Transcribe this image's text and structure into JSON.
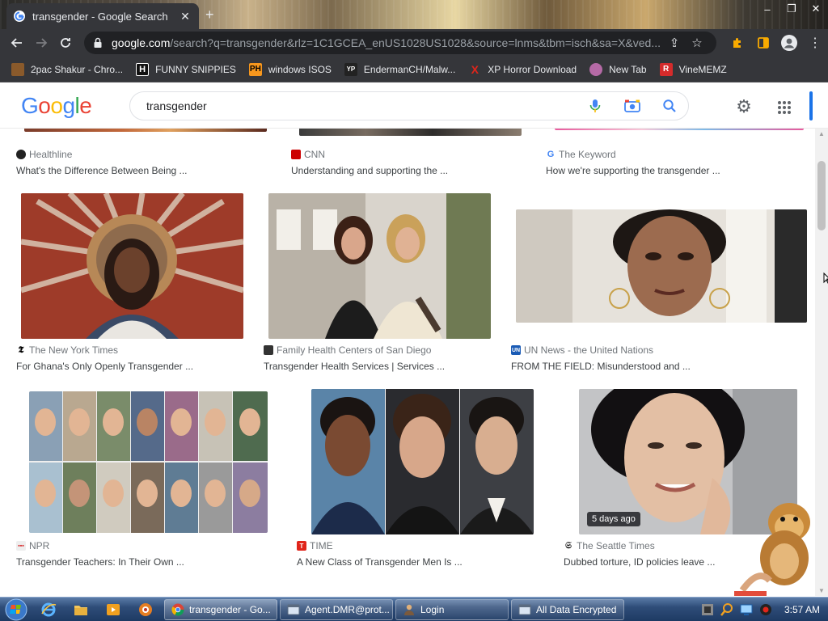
{
  "browser": {
    "tab_title": "transgender - Google Search",
    "tab_close": "✕",
    "new_tab": "+",
    "url_domain": "google.com",
    "url_rest": "/search?q=transgender&rlz=1C1GCEA_enUS1028US1028&source=lnms&tbm=isch&sa=X&ved...",
    "window_controls": [
      "–",
      "❐",
      "✕"
    ]
  },
  "bookmarks": [
    {
      "label": "2pac Shakur - Chro...",
      "icon": "album-icon",
      "color": "#8a5a2b"
    },
    {
      "label": "FUNNY SNIPPIES",
      "icon": "H",
      "color": "#111111"
    },
    {
      "label": "windows ISOS",
      "icon": "PH",
      "color": "#f7971d"
    },
    {
      "label": "EndermanCH/Malw...",
      "icon": "YP",
      "color": "#222222"
    },
    {
      "label": "XP Horror Download",
      "icon": "X",
      "color": "#e0251b"
    },
    {
      "label": "New Tab",
      "icon": "globe-icon",
      "color": "#b56aa6"
    },
    {
      "label": "VineMEMZ",
      "icon": "R",
      "color": "#d52b2b"
    }
  ],
  "google": {
    "logo": [
      "G",
      "o",
      "o",
      "g",
      "l",
      "e"
    ],
    "query": "transgender"
  },
  "results": [
    {
      "source": "Healthline",
      "title": "What's the Difference Between Being ...",
      "icon_color": "#222222",
      "icon_text": "●"
    },
    {
      "source": "CNN",
      "title": "Understanding and supporting the ...",
      "icon_color": "#cc0000",
      "icon_text": "C"
    },
    {
      "source": "The Keyword",
      "title": "How we're supporting the transgender ...",
      "icon_color": "#ffffff",
      "icon_text": "G"
    },
    {
      "source": "The New York Times",
      "title": "For Ghana's Only Openly Transgender ...",
      "icon_color": "#ffffff",
      "icon_text": "𝕿"
    },
    {
      "source": "Family Health Centers of San Diego",
      "title": "Transgender Health Services | Services ...",
      "icon_color": "#333333",
      "icon_text": "▣"
    },
    {
      "source": "UN News - the United Nations",
      "title": "FROM THE FIELD: Misunderstood and ...",
      "icon_color": "#1a5bb5",
      "icon_text": "UN"
    },
    {
      "source": "NPR",
      "title": "Transgender Teachers: In Their Own ...",
      "icon_color": "#ffffff",
      "icon_text": "▪"
    },
    {
      "source": "TIME",
      "title": "A New Class of Transgender Men Is ...",
      "icon_color": "#e0251b",
      "icon_text": "T"
    },
    {
      "source": "The Seattle Times",
      "title": "Dubbed torture, ID policies leave ...",
      "icon_color": "#ffffff",
      "icon_text": "S"
    }
  ],
  "badge": "5 days ago",
  "taskbar": {
    "tasks": [
      {
        "label": "transgender - Go..."
      },
      {
        "label": "Agent.DMR@prot..."
      },
      {
        "label": "Login"
      },
      {
        "label": "All Data Encrypted"
      }
    ],
    "clock": "3:57 AM"
  }
}
